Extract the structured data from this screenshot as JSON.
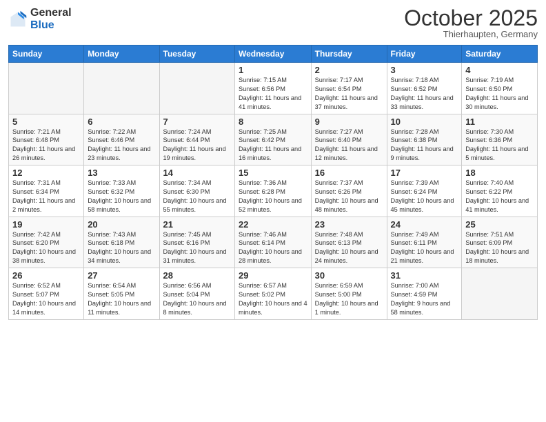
{
  "logo": {
    "general": "General",
    "blue": "Blue"
  },
  "header": {
    "month": "October 2025",
    "location": "Thierhaupten, Germany"
  },
  "days_of_week": [
    "Sunday",
    "Monday",
    "Tuesday",
    "Wednesday",
    "Thursday",
    "Friday",
    "Saturday"
  ],
  "weeks": [
    [
      {
        "day": "",
        "info": ""
      },
      {
        "day": "",
        "info": ""
      },
      {
        "day": "",
        "info": ""
      },
      {
        "day": "1",
        "info": "Sunrise: 7:15 AM\nSunset: 6:56 PM\nDaylight: 11 hours and 41 minutes."
      },
      {
        "day": "2",
        "info": "Sunrise: 7:17 AM\nSunset: 6:54 PM\nDaylight: 11 hours and 37 minutes."
      },
      {
        "day": "3",
        "info": "Sunrise: 7:18 AM\nSunset: 6:52 PM\nDaylight: 11 hours and 33 minutes."
      },
      {
        "day": "4",
        "info": "Sunrise: 7:19 AM\nSunset: 6:50 PM\nDaylight: 11 hours and 30 minutes."
      }
    ],
    [
      {
        "day": "5",
        "info": "Sunrise: 7:21 AM\nSunset: 6:48 PM\nDaylight: 11 hours and 26 minutes."
      },
      {
        "day": "6",
        "info": "Sunrise: 7:22 AM\nSunset: 6:46 PM\nDaylight: 11 hours and 23 minutes."
      },
      {
        "day": "7",
        "info": "Sunrise: 7:24 AM\nSunset: 6:44 PM\nDaylight: 11 hours and 19 minutes."
      },
      {
        "day": "8",
        "info": "Sunrise: 7:25 AM\nSunset: 6:42 PM\nDaylight: 11 hours and 16 minutes."
      },
      {
        "day": "9",
        "info": "Sunrise: 7:27 AM\nSunset: 6:40 PM\nDaylight: 11 hours and 12 minutes."
      },
      {
        "day": "10",
        "info": "Sunrise: 7:28 AM\nSunset: 6:38 PM\nDaylight: 11 hours and 9 minutes."
      },
      {
        "day": "11",
        "info": "Sunrise: 7:30 AM\nSunset: 6:36 PM\nDaylight: 11 hours and 5 minutes."
      }
    ],
    [
      {
        "day": "12",
        "info": "Sunrise: 7:31 AM\nSunset: 6:34 PM\nDaylight: 11 hours and 2 minutes."
      },
      {
        "day": "13",
        "info": "Sunrise: 7:33 AM\nSunset: 6:32 PM\nDaylight: 10 hours and 58 minutes."
      },
      {
        "day": "14",
        "info": "Sunrise: 7:34 AM\nSunset: 6:30 PM\nDaylight: 10 hours and 55 minutes."
      },
      {
        "day": "15",
        "info": "Sunrise: 7:36 AM\nSunset: 6:28 PM\nDaylight: 10 hours and 52 minutes."
      },
      {
        "day": "16",
        "info": "Sunrise: 7:37 AM\nSunset: 6:26 PM\nDaylight: 10 hours and 48 minutes."
      },
      {
        "day": "17",
        "info": "Sunrise: 7:39 AM\nSunset: 6:24 PM\nDaylight: 10 hours and 45 minutes."
      },
      {
        "day": "18",
        "info": "Sunrise: 7:40 AM\nSunset: 6:22 PM\nDaylight: 10 hours and 41 minutes."
      }
    ],
    [
      {
        "day": "19",
        "info": "Sunrise: 7:42 AM\nSunset: 6:20 PM\nDaylight: 10 hours and 38 minutes."
      },
      {
        "day": "20",
        "info": "Sunrise: 7:43 AM\nSunset: 6:18 PM\nDaylight: 10 hours and 34 minutes."
      },
      {
        "day": "21",
        "info": "Sunrise: 7:45 AM\nSunset: 6:16 PM\nDaylight: 10 hours and 31 minutes."
      },
      {
        "day": "22",
        "info": "Sunrise: 7:46 AM\nSunset: 6:14 PM\nDaylight: 10 hours and 28 minutes."
      },
      {
        "day": "23",
        "info": "Sunrise: 7:48 AM\nSunset: 6:13 PM\nDaylight: 10 hours and 24 minutes."
      },
      {
        "day": "24",
        "info": "Sunrise: 7:49 AM\nSunset: 6:11 PM\nDaylight: 10 hours and 21 minutes."
      },
      {
        "day": "25",
        "info": "Sunrise: 7:51 AM\nSunset: 6:09 PM\nDaylight: 10 hours and 18 minutes."
      }
    ],
    [
      {
        "day": "26",
        "info": "Sunrise: 6:52 AM\nSunset: 5:07 PM\nDaylight: 10 hours and 14 minutes."
      },
      {
        "day": "27",
        "info": "Sunrise: 6:54 AM\nSunset: 5:05 PM\nDaylight: 10 hours and 11 minutes."
      },
      {
        "day": "28",
        "info": "Sunrise: 6:56 AM\nSunset: 5:04 PM\nDaylight: 10 hours and 8 minutes."
      },
      {
        "day": "29",
        "info": "Sunrise: 6:57 AM\nSunset: 5:02 PM\nDaylight: 10 hours and 4 minutes."
      },
      {
        "day": "30",
        "info": "Sunrise: 6:59 AM\nSunset: 5:00 PM\nDaylight: 10 hours and 1 minute."
      },
      {
        "day": "31",
        "info": "Sunrise: 7:00 AM\nSunset: 4:59 PM\nDaylight: 9 hours and 58 minutes."
      },
      {
        "day": "",
        "info": ""
      }
    ]
  ]
}
